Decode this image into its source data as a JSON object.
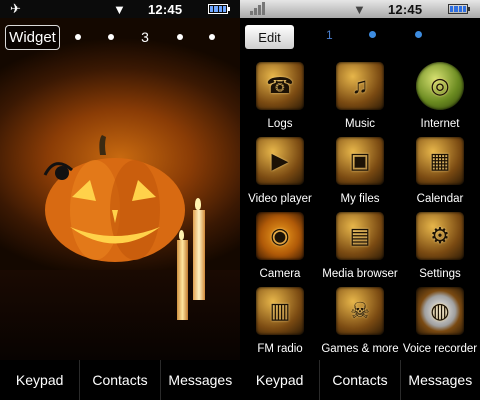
{
  "left": {
    "status": {
      "clock": "12:45",
      "flight_icon": "airplane-icon",
      "wifi_icon": "signal-down-icon",
      "battery_icon": "battery-icon"
    },
    "widget_label": "Widget",
    "pager": {
      "current": "3"
    },
    "softkeys": [
      "Keypad",
      "Contacts",
      "Messages"
    ]
  },
  "right": {
    "status": {
      "clock": "12:45",
      "signal_icon": "signal-bars-icon",
      "wifi_icon": "signal-down-icon",
      "battery_icon": "battery-icon"
    },
    "edit_label": "Edit",
    "pager": {
      "current": "1"
    },
    "apps": [
      {
        "label": "Logs",
        "icon": "logs-icon"
      },
      {
        "label": "Music",
        "icon": "music-icon"
      },
      {
        "label": "Internet",
        "icon": "globe-icon"
      },
      {
        "label": "Video player",
        "icon": "film-icon"
      },
      {
        "label": "My files",
        "icon": "folder-icon"
      },
      {
        "label": "Calendar",
        "icon": "calendar-icon"
      },
      {
        "label": "Camera",
        "icon": "camera-icon"
      },
      {
        "label": "Media browser",
        "icon": "media-browser-icon"
      },
      {
        "label": "Settings",
        "icon": "settings-icon"
      },
      {
        "label": "FM radio",
        "icon": "radio-icon"
      },
      {
        "label": "Games & more",
        "icon": "games-icon"
      },
      {
        "label": "Voice recorder",
        "icon": "voice-recorder-icon"
      }
    ],
    "softkeys": [
      "Keypad",
      "Contacts",
      "Messages"
    ]
  },
  "colors": {
    "accent_blue": "#3d8ce0",
    "wallpaper_orange": "#c86a10"
  }
}
